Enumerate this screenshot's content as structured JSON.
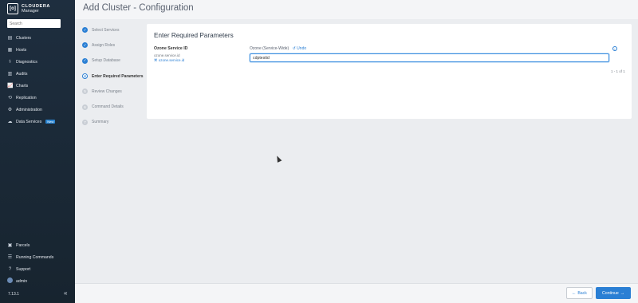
{
  "app": {
    "brand_line1": "CLOUDERA",
    "brand_line2": "Manager",
    "logo_glyph": "[o]",
    "search_placeholder": "Search",
    "version": "7.13.1"
  },
  "sidebar": {
    "items": [
      {
        "label": "Clusters",
        "icon": "clusters-icon",
        "glyph": "▤"
      },
      {
        "label": "Hosts",
        "icon": "hosts-icon",
        "glyph": "▦"
      },
      {
        "label": "Diagnostics",
        "icon": "diagnostics-icon",
        "glyph": "⚕"
      },
      {
        "label": "Audits",
        "icon": "audits-icon",
        "glyph": "▥"
      },
      {
        "label": "Charts",
        "icon": "charts-icon",
        "glyph": "📈"
      },
      {
        "label": "Replication",
        "icon": "replication-icon",
        "glyph": "⟲"
      },
      {
        "label": "Administration",
        "icon": "gear-icon",
        "glyph": "⚙"
      },
      {
        "label": "Data Services",
        "icon": "data-services-icon",
        "glyph": "☁",
        "badge": "New"
      }
    ],
    "bottom_items": [
      {
        "label": "Parcels",
        "icon": "parcels-icon",
        "glyph": "▣"
      },
      {
        "label": "Running Commands",
        "icon": "commands-icon",
        "glyph": "☰"
      },
      {
        "label": "Support",
        "icon": "support-icon",
        "glyph": "?"
      },
      {
        "label": "admin",
        "icon": "avatar-icon"
      }
    ],
    "collapse_glyph": "«"
  },
  "header": {
    "title": "Add Cluster - Configuration"
  },
  "steps": [
    {
      "label": "Select Services",
      "state": "done",
      "marker": "✓"
    },
    {
      "label": "Assign Roles",
      "state": "done",
      "marker": "✓"
    },
    {
      "label": "Setup Database",
      "state": "done",
      "marker": "✓"
    },
    {
      "label": "Enter Required Parameters",
      "state": "current",
      "marker": "4"
    },
    {
      "label": "Review Changes",
      "state": "todo",
      "marker": "5"
    },
    {
      "label": "Command Details",
      "state": "todo",
      "marker": "6"
    },
    {
      "label": "Summary",
      "state": "todo",
      "marker": "7"
    }
  ],
  "main": {
    "section_title": "Enter Required Parameters",
    "param": {
      "name": "Ozone Service ID",
      "key": "ozone.service.id",
      "link": "ozone.service.id",
      "link_glyph": "⌘",
      "scope": "Ozone (Service-Wide)",
      "undo_label": "Undo",
      "undo_glyph": "↺",
      "value": "cdptestid"
    },
    "info_glyph": "i",
    "pager": "1 - 1 of 1"
  },
  "footer": {
    "back_label": "Back",
    "back_glyph": "←",
    "continue_label": "Continue",
    "continue_glyph": "→"
  },
  "colors": {
    "accent": "#2a7fd4",
    "sidebar_bg": "#1b2a3a",
    "page_bg": "#ebedf0"
  }
}
